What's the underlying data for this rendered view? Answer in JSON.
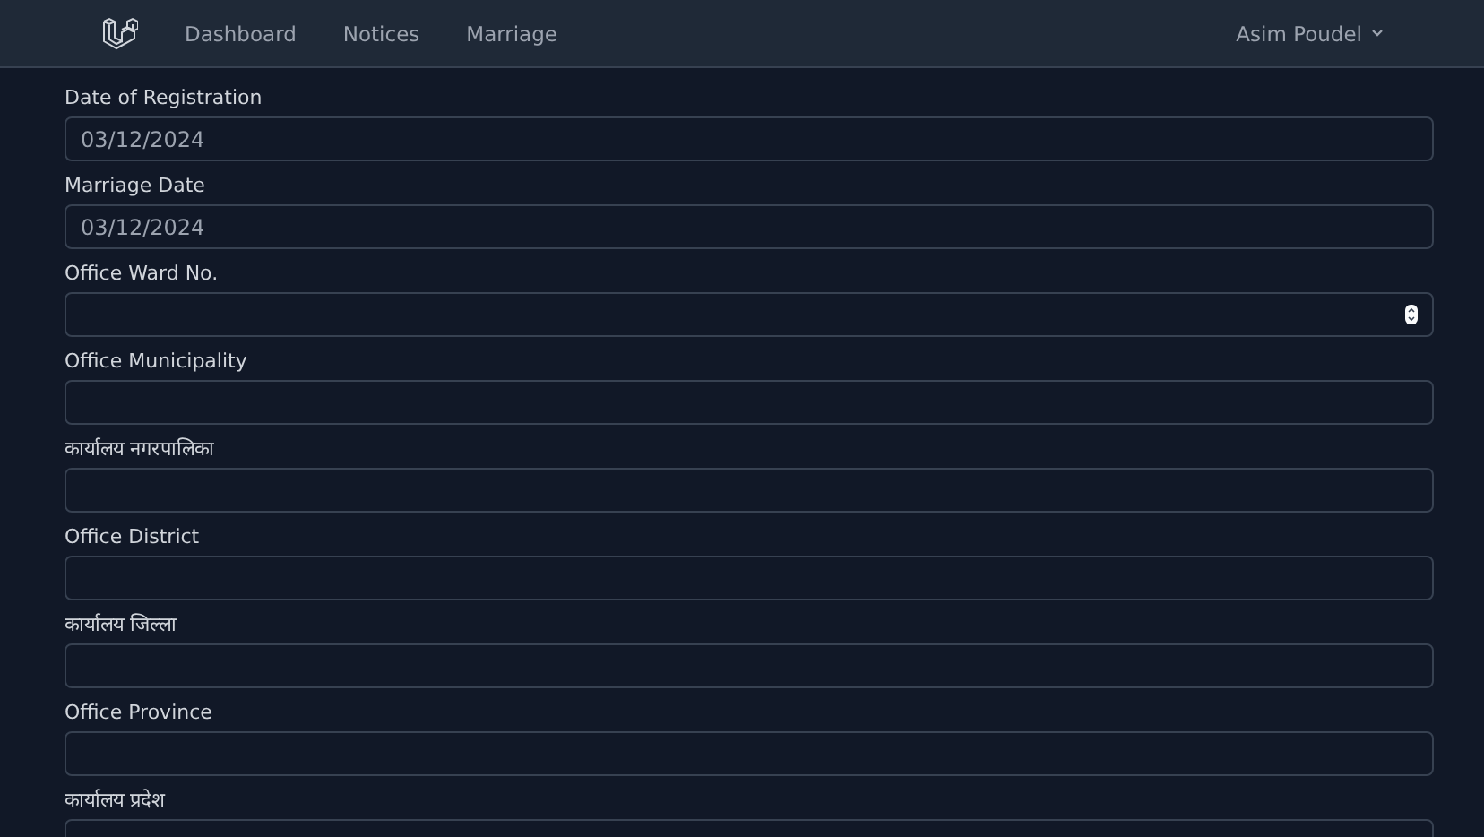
{
  "nav": {
    "links": [
      {
        "label": "Dashboard"
      },
      {
        "label": "Notices"
      },
      {
        "label": "Marriage"
      }
    ],
    "user": "Asim Poudel"
  },
  "fields": [
    {
      "label": "Date of Registration",
      "kind": "date",
      "value": "03/12/2024"
    },
    {
      "label": "Marriage Date",
      "kind": "date",
      "value": "03/12/2024"
    },
    {
      "label": "Office Ward No.",
      "kind": "number"
    },
    {
      "label": "Office Municipality",
      "kind": "text"
    },
    {
      "label": "कार्यालय नगरपालिका",
      "kind": "text"
    },
    {
      "label": "Office District",
      "kind": "text"
    },
    {
      "label": "कार्यालय जिल्ला",
      "kind": "text"
    },
    {
      "label": "Office Province",
      "kind": "text"
    },
    {
      "label": "कार्यालय प्रदेश",
      "kind": "text"
    }
  ]
}
